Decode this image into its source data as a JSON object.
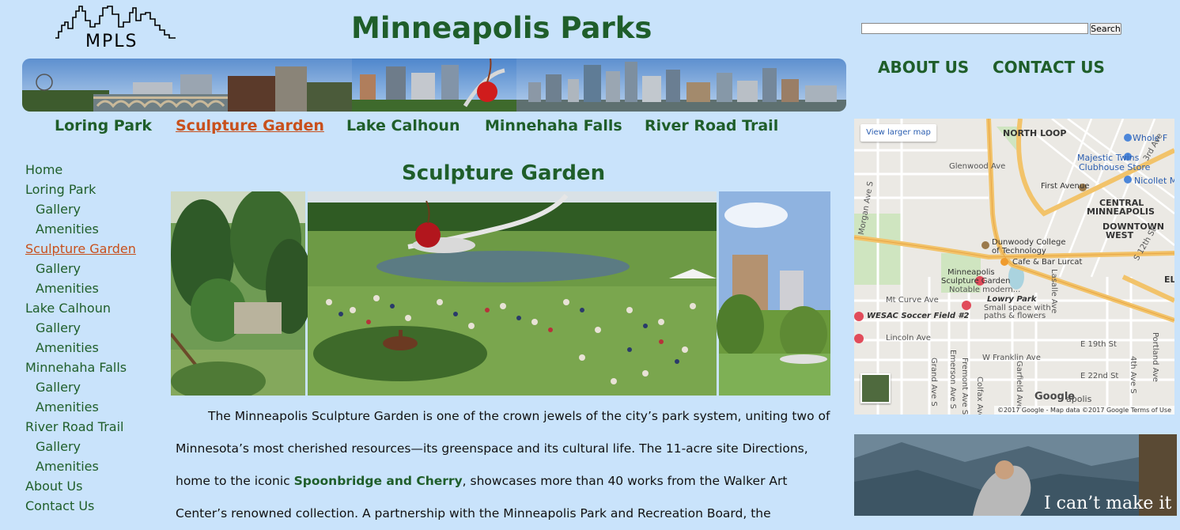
{
  "site": {
    "logo_text": "MPLS",
    "title": "Minneapolis Parks"
  },
  "top_nav": [
    {
      "label": "Loring Park"
    },
    {
      "label": "Sculpture Garden"
    },
    {
      "label": "Lake Calhoun"
    },
    {
      "label": "Minnehaha Falls"
    },
    {
      "label": "River Road Trail"
    }
  ],
  "top_nav_active": "Sculpture Garden",
  "search": {
    "value": "",
    "button_label": "Search"
  },
  "side_links": {
    "about": "ABOUT US",
    "contact": "CONTACT US"
  },
  "left_nav": [
    {
      "label": "Home",
      "sub": false
    },
    {
      "label": "Loring Park",
      "sub": false
    },
    {
      "label": "Gallery",
      "sub": true
    },
    {
      "label": "Amenities",
      "sub": true
    },
    {
      "label": "Sculpture Garden",
      "sub": false,
      "active": true
    },
    {
      "label": "Gallery",
      "sub": true
    },
    {
      "label": "Amenities",
      "sub": true
    },
    {
      "label": "Lake Calhoun",
      "sub": false
    },
    {
      "label": "Gallery",
      "sub": true
    },
    {
      "label": "Amenities",
      "sub": true
    },
    {
      "label": "Minnehaha Falls",
      "sub": false
    },
    {
      "label": "Gallery",
      "sub": true
    },
    {
      "label": "Amenities",
      "sub": true
    },
    {
      "label": "River Road Trail",
      "sub": false
    },
    {
      "label": "Gallery",
      "sub": true
    },
    {
      "label": "Amenities",
      "sub": true
    },
    {
      "label": "About Us",
      "sub": false
    },
    {
      "label": "Contact Us",
      "sub": false
    }
  ],
  "main": {
    "heading": "Sculpture Garden",
    "body_before_link": "The Minneapolis Sculpture Garden is one of the crown jewels of the city’s park system, uniting two of Minnesota’s most cherished resources—its greenspace and its cultural life. The 11-acre site Directions, home to the iconic ",
    "body_link": "Spoonbridge and Cherry",
    "body_after_link": ", showcases more than 40 works from the Walker Art Center’s renowned collection. A partnership with the Minneapolis Park and Recreation Board, the"
  },
  "map": {
    "view_larger": "View larger map",
    "google": "Google",
    "attribution": "©2017 Google - Map data ©2017 Google    Terms of Use",
    "labels": {
      "north_loop": "NORTH LOOP",
      "whole_foods": "Whole F",
      "majestic": "Majestic Twins",
      "clubhouse": "Clubhouse Store",
      "glenwood": "Glenwood Ave",
      "first_ave": "First Avenue",
      "nicollet": "Nicollet M",
      "central": "CENTRAL",
      "minneapolis": "MINNEAPOLIS",
      "downtown": "DOWNTOWN",
      "west": "WEST",
      "dunwoody1": "Dunwoody College",
      "dunwoody2": "of Technology",
      "cafe": "Cafe & Bar Lurcat",
      "msg1": "Minneapolis",
      "msg2": "Sculpture Garden",
      "msg3": "Notable modern...",
      "lowry1": "Lowry Park",
      "lowry2": "Small space with",
      "lowry3": "paths & flowers",
      "wesac": "WESAC Soccer Field #2",
      "mt_curve": "Mt Curve Ave",
      "lincoln": "Lincoln Ave",
      "franklin": "W Franklin Ave",
      "e19": "E 19th St",
      "e22": "E 22nd St",
      "morgan": "Morgan Ave S",
      "emerson": "Emerson Ave S",
      "fremont": "Fremont Ave S",
      "grand": "Grand Ave S",
      "colfax": "Colfax Ave S",
      "garfield": "Garfield Ave",
      "lasalle": "Lasalle Ave",
      "fourth": "4th Ave S",
      "portland": "Portland Ave",
      "elli": "ELL",
      "twelfth": "S 12th St",
      "third": "3rd Ave",
      "apolis": "apolis"
    }
  },
  "ad": {
    "text": "I can’t make it"
  },
  "colors": {
    "background": "#c9e3fb",
    "brand_green": "#1f5e2a",
    "active_orange": "#c8501c"
  }
}
